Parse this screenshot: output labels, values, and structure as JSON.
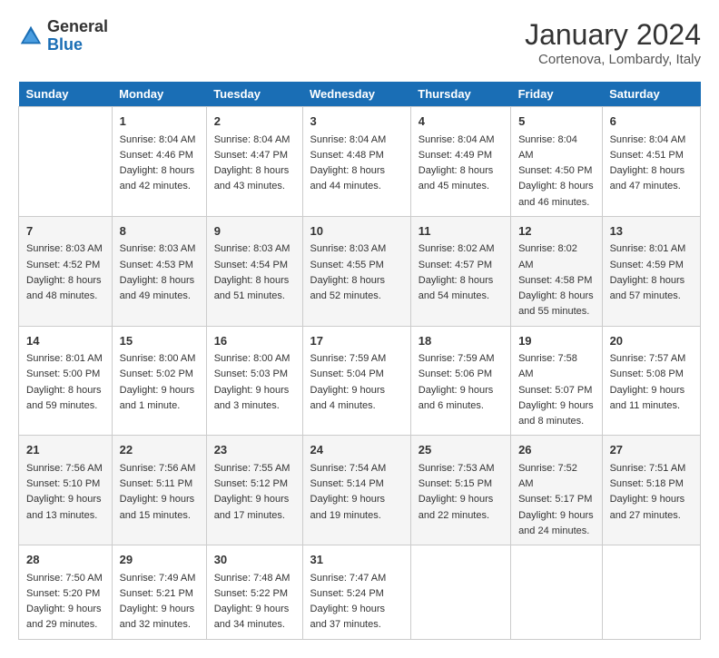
{
  "logo": {
    "line1": "General",
    "line2": "Blue"
  },
  "title": "January 2024",
  "subtitle": "Cortenova, Lombardy, Italy",
  "headers": [
    "Sunday",
    "Monday",
    "Tuesday",
    "Wednesday",
    "Thursday",
    "Friday",
    "Saturday"
  ],
  "weeks": [
    [
      {
        "day": "",
        "sunrise": "",
        "sunset": "",
        "daylight": ""
      },
      {
        "day": "1",
        "sunrise": "Sunrise: 8:04 AM",
        "sunset": "Sunset: 4:46 PM",
        "daylight": "Daylight: 8 hours and 42 minutes."
      },
      {
        "day": "2",
        "sunrise": "Sunrise: 8:04 AM",
        "sunset": "Sunset: 4:47 PM",
        "daylight": "Daylight: 8 hours and 43 minutes."
      },
      {
        "day": "3",
        "sunrise": "Sunrise: 8:04 AM",
        "sunset": "Sunset: 4:48 PM",
        "daylight": "Daylight: 8 hours and 44 minutes."
      },
      {
        "day": "4",
        "sunrise": "Sunrise: 8:04 AM",
        "sunset": "Sunset: 4:49 PM",
        "daylight": "Daylight: 8 hours and 45 minutes."
      },
      {
        "day": "5",
        "sunrise": "Sunrise: 8:04 AM",
        "sunset": "Sunset: 4:50 PM",
        "daylight": "Daylight: 8 hours and 46 minutes."
      },
      {
        "day": "6",
        "sunrise": "Sunrise: 8:04 AM",
        "sunset": "Sunset: 4:51 PM",
        "daylight": "Daylight: 8 hours and 47 minutes."
      }
    ],
    [
      {
        "day": "7",
        "sunrise": "Sunrise: 8:03 AM",
        "sunset": "Sunset: 4:52 PM",
        "daylight": "Daylight: 8 hours and 48 minutes."
      },
      {
        "day": "8",
        "sunrise": "Sunrise: 8:03 AM",
        "sunset": "Sunset: 4:53 PM",
        "daylight": "Daylight: 8 hours and 49 minutes."
      },
      {
        "day": "9",
        "sunrise": "Sunrise: 8:03 AM",
        "sunset": "Sunset: 4:54 PM",
        "daylight": "Daylight: 8 hours and 51 minutes."
      },
      {
        "day": "10",
        "sunrise": "Sunrise: 8:03 AM",
        "sunset": "Sunset: 4:55 PM",
        "daylight": "Daylight: 8 hours and 52 minutes."
      },
      {
        "day": "11",
        "sunrise": "Sunrise: 8:02 AM",
        "sunset": "Sunset: 4:57 PM",
        "daylight": "Daylight: 8 hours and 54 minutes."
      },
      {
        "day": "12",
        "sunrise": "Sunrise: 8:02 AM",
        "sunset": "Sunset: 4:58 PM",
        "daylight": "Daylight: 8 hours and 55 minutes."
      },
      {
        "day": "13",
        "sunrise": "Sunrise: 8:01 AM",
        "sunset": "Sunset: 4:59 PM",
        "daylight": "Daylight: 8 hours and 57 minutes."
      }
    ],
    [
      {
        "day": "14",
        "sunrise": "Sunrise: 8:01 AM",
        "sunset": "Sunset: 5:00 PM",
        "daylight": "Daylight: 8 hours and 59 minutes."
      },
      {
        "day": "15",
        "sunrise": "Sunrise: 8:00 AM",
        "sunset": "Sunset: 5:02 PM",
        "daylight": "Daylight: 9 hours and 1 minute."
      },
      {
        "day": "16",
        "sunrise": "Sunrise: 8:00 AM",
        "sunset": "Sunset: 5:03 PM",
        "daylight": "Daylight: 9 hours and 3 minutes."
      },
      {
        "day": "17",
        "sunrise": "Sunrise: 7:59 AM",
        "sunset": "Sunset: 5:04 PM",
        "daylight": "Daylight: 9 hours and 4 minutes."
      },
      {
        "day": "18",
        "sunrise": "Sunrise: 7:59 AM",
        "sunset": "Sunset: 5:06 PM",
        "daylight": "Daylight: 9 hours and 6 minutes."
      },
      {
        "day": "19",
        "sunrise": "Sunrise: 7:58 AM",
        "sunset": "Sunset: 5:07 PM",
        "daylight": "Daylight: 9 hours and 8 minutes."
      },
      {
        "day": "20",
        "sunrise": "Sunrise: 7:57 AM",
        "sunset": "Sunset: 5:08 PM",
        "daylight": "Daylight: 9 hours and 11 minutes."
      }
    ],
    [
      {
        "day": "21",
        "sunrise": "Sunrise: 7:56 AM",
        "sunset": "Sunset: 5:10 PM",
        "daylight": "Daylight: 9 hours and 13 minutes."
      },
      {
        "day": "22",
        "sunrise": "Sunrise: 7:56 AM",
        "sunset": "Sunset: 5:11 PM",
        "daylight": "Daylight: 9 hours and 15 minutes."
      },
      {
        "day": "23",
        "sunrise": "Sunrise: 7:55 AM",
        "sunset": "Sunset: 5:12 PM",
        "daylight": "Daylight: 9 hours and 17 minutes."
      },
      {
        "day": "24",
        "sunrise": "Sunrise: 7:54 AM",
        "sunset": "Sunset: 5:14 PM",
        "daylight": "Daylight: 9 hours and 19 minutes."
      },
      {
        "day": "25",
        "sunrise": "Sunrise: 7:53 AM",
        "sunset": "Sunset: 5:15 PM",
        "daylight": "Daylight: 9 hours and 22 minutes."
      },
      {
        "day": "26",
        "sunrise": "Sunrise: 7:52 AM",
        "sunset": "Sunset: 5:17 PM",
        "daylight": "Daylight: 9 hours and 24 minutes."
      },
      {
        "day": "27",
        "sunrise": "Sunrise: 7:51 AM",
        "sunset": "Sunset: 5:18 PM",
        "daylight": "Daylight: 9 hours and 27 minutes."
      }
    ],
    [
      {
        "day": "28",
        "sunrise": "Sunrise: 7:50 AM",
        "sunset": "Sunset: 5:20 PM",
        "daylight": "Daylight: 9 hours and 29 minutes."
      },
      {
        "day": "29",
        "sunrise": "Sunrise: 7:49 AM",
        "sunset": "Sunset: 5:21 PM",
        "daylight": "Daylight: 9 hours and 32 minutes."
      },
      {
        "day": "30",
        "sunrise": "Sunrise: 7:48 AM",
        "sunset": "Sunset: 5:22 PM",
        "daylight": "Daylight: 9 hours and 34 minutes."
      },
      {
        "day": "31",
        "sunrise": "Sunrise: 7:47 AM",
        "sunset": "Sunset: 5:24 PM",
        "daylight": "Daylight: 9 hours and 37 minutes."
      },
      {
        "day": "",
        "sunrise": "",
        "sunset": "",
        "daylight": ""
      },
      {
        "day": "",
        "sunrise": "",
        "sunset": "",
        "daylight": ""
      },
      {
        "day": "",
        "sunrise": "",
        "sunset": "",
        "daylight": ""
      }
    ]
  ]
}
